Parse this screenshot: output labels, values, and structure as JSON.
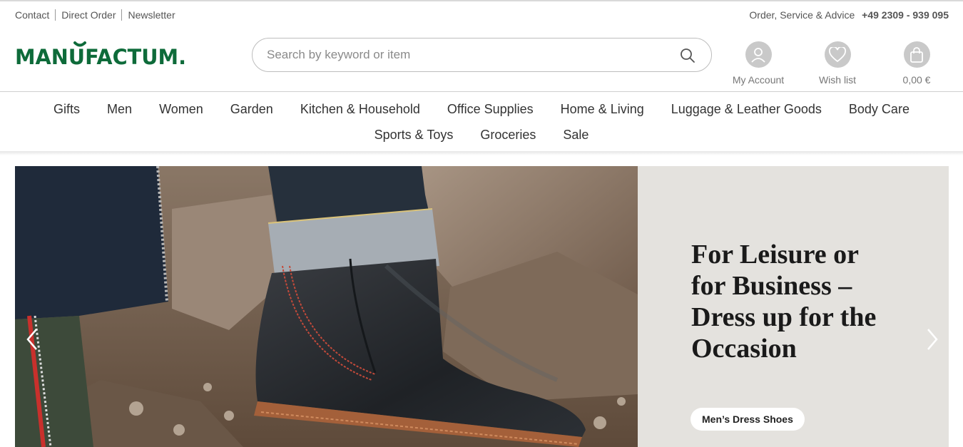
{
  "topbar": {
    "links": [
      "Contact",
      "Direct Order",
      "Newsletter"
    ],
    "service_label": "Order, Service & Advice",
    "phone": "+49 2309 - 939 095"
  },
  "logo": {
    "text": "MANUFACTUM.",
    "color": "#0e6b3a"
  },
  "search": {
    "placeholder": "Search by keyword or item",
    "value": ""
  },
  "header_icons": {
    "account": {
      "label": "My Account",
      "icon": "user-icon"
    },
    "wishlist": {
      "label": "Wish list",
      "icon": "heart-icon"
    },
    "cart": {
      "label": "0,00 €",
      "icon": "shopping-bag-icon"
    }
  },
  "nav": {
    "row1": [
      "Gifts",
      "Men",
      "Women",
      "Garden",
      "Kitchen & Household",
      "Office Supplies",
      "Home & Living",
      "Luggage & Leather Goods",
      "Body Care"
    ],
    "row2": [
      "Sports & Toys",
      "Groceries",
      "Sale"
    ]
  },
  "hero": {
    "title_lines": [
      "For Leisure or",
      "for Business –",
      "Dress up for the",
      "Occasion"
    ],
    "button_label": "Men’s Dress Shoes",
    "panel_color": "#e4e2de"
  },
  "colors": {
    "brand_green": "#0e6b3a",
    "icon_gray": "#c9c9c9",
    "text_dark": "#333333"
  }
}
